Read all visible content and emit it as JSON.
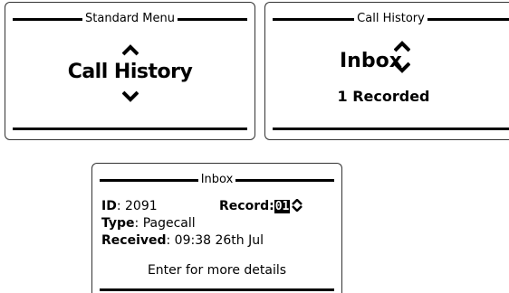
{
  "screens": {
    "standard_menu": {
      "title": "Standard Menu",
      "item": "Call History",
      "up_icon": "chevron-up-icon",
      "down_icon": "chevron-down-icon"
    },
    "call_history": {
      "title": "Call History",
      "item": "Inbox",
      "count": "1 Recorded",
      "up_icon": "chevron-up-icon",
      "down_icon": "chevron-down-icon"
    },
    "inbox": {
      "title": "Inbox",
      "id_label": "ID",
      "id_value": ": 2091",
      "record_label": "Record",
      "record_sep": ":",
      "record_value": "01",
      "record_icon": "up-down-arrow-icon",
      "type_label": "Type",
      "type_value": ": Pagecall",
      "received_label": "Received",
      "received_value": ": 09:38 26th Jul",
      "hint": "Enter for more details"
    }
  }
}
